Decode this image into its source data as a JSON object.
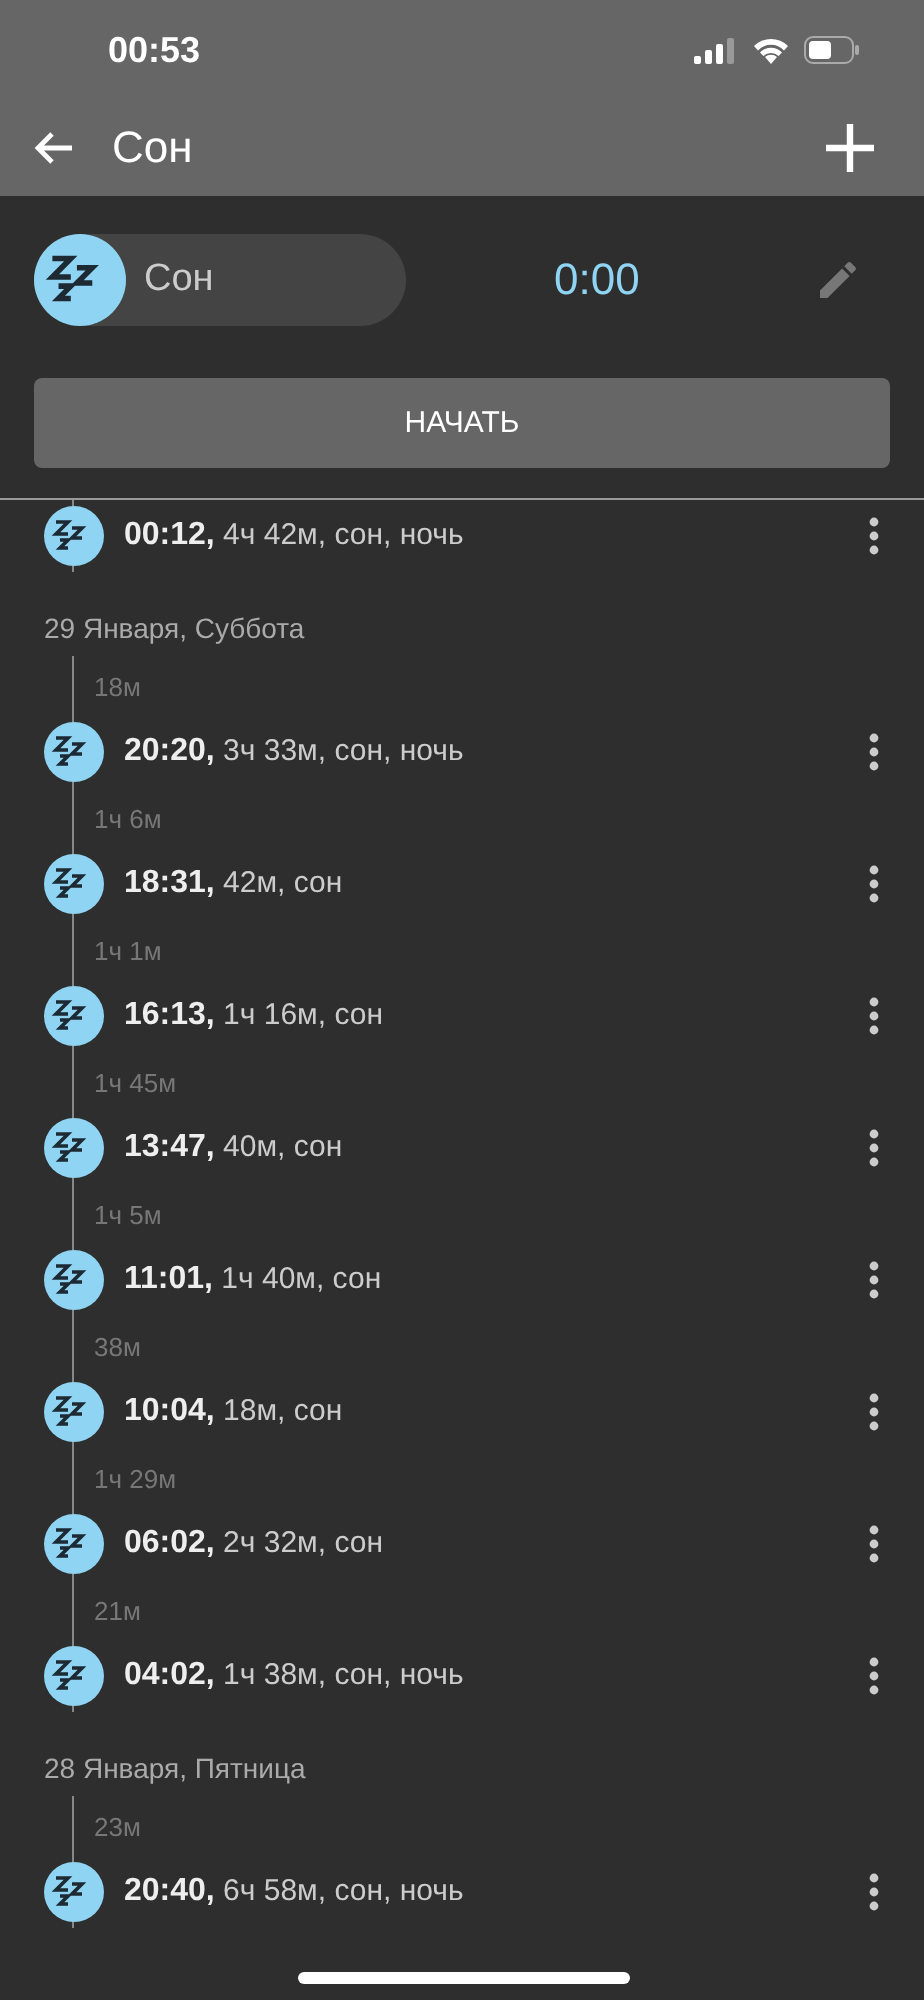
{
  "status_bar": {
    "time": "00:53"
  },
  "app_bar": {
    "title": "Сон"
  },
  "activity": {
    "name": "Сон",
    "timer": "0:00"
  },
  "start_button": "НАЧАТЬ",
  "timeline": [
    {
      "kind": "entry",
      "text": "**00:12,** 4ч 42м, сон, ночь"
    },
    {
      "kind": "date",
      "text": "29 Января, Суббота"
    },
    {
      "kind": "gap",
      "text": "18м"
    },
    {
      "kind": "entry",
      "text": "**20:20,** 3ч 33м, сон, ночь"
    },
    {
      "kind": "gap",
      "text": "1ч 6м"
    },
    {
      "kind": "entry",
      "text": "**18:31,** 42м, сон"
    },
    {
      "kind": "gap",
      "text": "1ч 1м"
    },
    {
      "kind": "entry",
      "text": "**16:13,** 1ч 16м, сон"
    },
    {
      "kind": "gap",
      "text": "1ч 45м"
    },
    {
      "kind": "entry",
      "text": "**13:47,** 40м, сон"
    },
    {
      "kind": "gap",
      "text": "1ч 5м"
    },
    {
      "kind": "entry",
      "text": "**11:01,** 1ч 40м, сон"
    },
    {
      "kind": "gap",
      "text": "38м"
    },
    {
      "kind": "entry",
      "text": "**10:04,** 18м, сон"
    },
    {
      "kind": "gap",
      "text": "1ч 29м"
    },
    {
      "kind": "entry",
      "text": "**06:02,** 2ч 32м, сон"
    },
    {
      "kind": "gap",
      "text": "21м"
    },
    {
      "kind": "entry",
      "text": "**04:02,** 1ч 38м, сон, ночь"
    },
    {
      "kind": "date",
      "text": "28 Января, Пятница"
    },
    {
      "kind": "gap",
      "text": "23м"
    },
    {
      "kind": "entry",
      "text": "**20:40,** 6ч 58м, сон, ночь"
    }
  ]
}
